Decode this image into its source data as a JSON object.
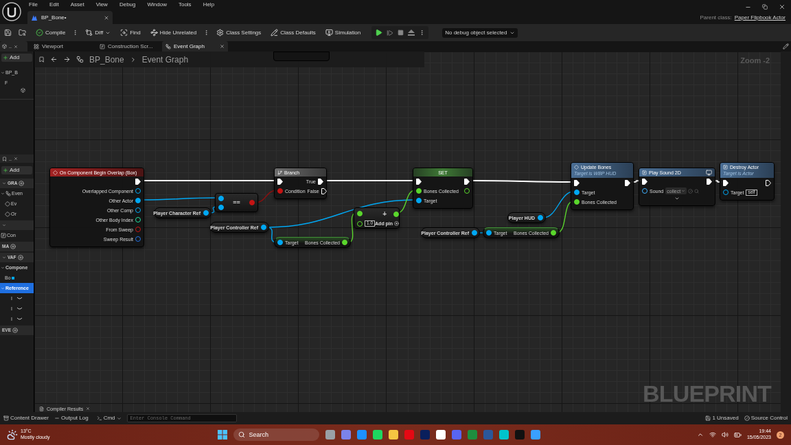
{
  "menu": [
    "File",
    "Edit",
    "Asset",
    "View",
    "Debug",
    "Window",
    "Tools",
    "Help"
  ],
  "document_tab": {
    "title": "BP_Bone•"
  },
  "parent_class": {
    "label": "Parent class:",
    "value": "Paper Flipbook Actor"
  },
  "toolbar": [
    {
      "kind": "compile",
      "label": "Compile"
    },
    {
      "kind": "diff",
      "label": "Diff"
    },
    {
      "kind": "find",
      "label": "Find"
    },
    {
      "kind": "hide",
      "label": "Hide Unrelated"
    },
    {
      "kind": "settings",
      "label": "Class Settings"
    },
    {
      "kind": "defaults",
      "label": "Class Defaults"
    },
    {
      "kind": "simulation",
      "label": "Simulation"
    }
  ],
  "debug_selector": {
    "value": "No debug object selected"
  },
  "components_panel": {
    "tab": "..",
    "add": "Add",
    "items": [
      {
        "label": "BP_B",
        "selected": false,
        "children": [
          {
            "label": "F",
            "selected": false
          }
        ]
      }
    ]
  },
  "editor_tabs": [
    {
      "kind": "viewport",
      "label": "Viewport",
      "selected": false
    },
    {
      "kind": "function",
      "label": "Construction Scr...",
      "selected": false
    },
    {
      "kind": "graph",
      "label": "Event Graph",
      "selected": true
    }
  ],
  "breadcrumb": [
    "BP_Bone",
    "Event Graph"
  ],
  "zoom_label": "Zoom -2",
  "graph_type_label": "BLUEPRINT",
  "my_blueprint_panel": {
    "tab": "..",
    "add": "Add",
    "sections": [
      {
        "label": "GRA",
        "expanded": true,
        "add": true,
        "items": [
          {
            "label": "Even",
            "kind": "graph",
            "selected": false,
            "children": [
              {
                "label": "Ev",
                "kind": "event",
                "selected": false
              },
              {
                "label": "Or",
                "kind": "event",
                "selected": false
              }
            ]
          }
        ]
      },
      {
        "expanded": true,
        "add": false,
        "items": [
          {
            "label": "Con",
            "kind": "function",
            "selected": false
          }
        ]
      },
      {
        "label": "MA",
        "add": true
      },
      {
        "label": "VAF",
        "expanded": true,
        "add": true,
        "items": [
          {
            "label": "Compone",
            "kind": "category",
            "selected": false,
            "children": [
              {
                "label": "Bo",
                "kind": "variable",
                "selected": false,
                "color": "#00a8f4"
              }
            ]
          },
          {
            "label": "Reference",
            "kind": "category",
            "selected": true,
            "children": [
              {
                "label": "I",
                "kind": "variable",
                "selected": false
              },
              {
                "label": "I",
                "kind": "variable",
                "selected": false
              },
              {
                "label": "I",
                "kind": "variable",
                "selected": false
              }
            ]
          }
        ]
      },
      {
        "label": "EVE",
        "add": true
      }
    ]
  },
  "nodes": [
    {
      "kind": "event",
      "title": "On Component Begin Overlap (Box)",
      "outputs": [
        {
          "kind": "exec",
          "connected": true
        },
        {
          "label": "Overlapped Component",
          "kind": "object",
          "connected": false
        },
        {
          "label": "Other Actor",
          "kind": "object",
          "connected": true
        },
        {
          "label": "Other Comp",
          "kind": "object",
          "connected": false
        },
        {
          "label": "Other Body Index",
          "kind": "int",
          "connected": false
        },
        {
          "label": "From Sweep",
          "kind": "bool",
          "connected": false
        },
        {
          "label": "Sweep Result",
          "kind": "struct",
          "connected": false
        }
      ]
    },
    {
      "kind": "operator",
      "title": "==",
      "inputs": [
        {
          "kind": "object",
          "connected": true
        },
        {
          "kind": "object",
          "connected": true
        }
      ],
      "outputs": [
        {
          "kind": "bool",
          "connected": true
        }
      ]
    },
    {
      "kind": "variable",
      "title": "Player Character Ref",
      "outputs": [
        {
          "kind": "object",
          "connected": true
        }
      ]
    },
    {
      "kind": "variable",
      "title": "Player Controller Ref",
      "outputs": [
        {
          "kind": "object",
          "connected": true
        }
      ]
    },
    {
      "kind": "flow",
      "title": "Branch",
      "inputs": [
        {
          "kind": "exec",
          "connected": true
        },
        {
          "label": "Condition",
          "kind": "bool",
          "connected": true
        }
      ],
      "outputs": [
        {
          "label": "True",
          "kind": "exec",
          "connected": true
        },
        {
          "label": "False",
          "kind": "exec",
          "connected": false
        }
      ]
    },
    {
      "kind": "getter",
      "inputs": [
        {
          "label": "Target",
          "kind": "object",
          "connected": true
        }
      ],
      "outputs": [
        {
          "label": "Bones Collected",
          "kind": "float",
          "connected": true
        }
      ]
    },
    {
      "kind": "math",
      "title": "+",
      "add_pin": "Add pin",
      "inputs": [
        {
          "kind": "float",
          "connected": true
        },
        {
          "kind": "float",
          "connected": false,
          "value": "1.0"
        }
      ],
      "outputs": [
        {
          "kind": "float",
          "connected": true
        }
      ]
    },
    {
      "kind": "set",
      "title": "SET",
      "inputs": [
        {
          "kind": "exec",
          "connected": true
        },
        {
          "label": "Bones Collected",
          "kind": "float",
          "connected": true
        },
        {
          "label": "Target",
          "kind": "object",
          "connected": true
        }
      ],
      "outputs": [
        {
          "kind": "exec",
          "connected": true
        },
        {
          "kind": "float",
          "connected": false
        }
      ]
    },
    {
      "kind": "variable",
      "title": "Player HUD",
      "outputs": [
        {
          "kind": "object",
          "connected": true
        }
      ]
    },
    {
      "kind": "variable",
      "title": "Player Controller Ref",
      "outputs": [
        {
          "kind": "object",
          "connected": true
        }
      ]
    },
    {
      "kind": "getter",
      "inputs": [
        {
          "label": "Target",
          "kind": "object",
          "connected": true
        }
      ],
      "outputs": [
        {
          "label": "Bones Collected",
          "kind": "float",
          "connected": true
        }
      ]
    },
    {
      "kind": "call",
      "title": "Update Bones",
      "subtitle": "Target is WBP HUD",
      "inputs": [
        {
          "kind": "exec",
          "connected": true
        },
        {
          "label": "Target",
          "kind": "object",
          "connected": true
        },
        {
          "label": "Bones Collected",
          "kind": "float",
          "connected": true
        }
      ],
      "outputs": [
        {
          "kind": "exec",
          "connected": true
        }
      ]
    },
    {
      "kind": "function",
      "title": "Play Sound 2D",
      "client_only": true,
      "advanced": true,
      "inputs": [
        {
          "kind": "exec",
          "connected": true
        },
        {
          "label": "Sound",
          "kind": "asset",
          "connected": false,
          "value": "collect"
        }
      ],
      "outputs": [
        {
          "kind": "exec",
          "connected": true
        }
      ]
    },
    {
      "kind": "function",
      "title": "Destroy Actor",
      "subtitle": "Target is Actor",
      "inputs": [
        {
          "kind": "exec",
          "connected": true
        },
        {
          "label": "Target",
          "kind": "object",
          "connected": false,
          "value": "self"
        }
      ],
      "outputs": [
        {
          "kind": "exec",
          "connected": false
        }
      ]
    }
  ],
  "compiler_results_tab": "Compiler Results",
  "bottom_bar": {
    "content_drawer": "Content Drawer",
    "output_log": "Output Log",
    "cmd": "Cmd",
    "console_placeholder": "Enter Console Command",
    "unsaved": "1 Unsaved",
    "source_control": "Source Control"
  },
  "taskbar": {
    "temperature": "13°C",
    "weather": "Mostly cloudy",
    "search_placeholder": "Search",
    "time": "19:44",
    "date": "15/05/2023",
    "notifications": "2"
  }
}
